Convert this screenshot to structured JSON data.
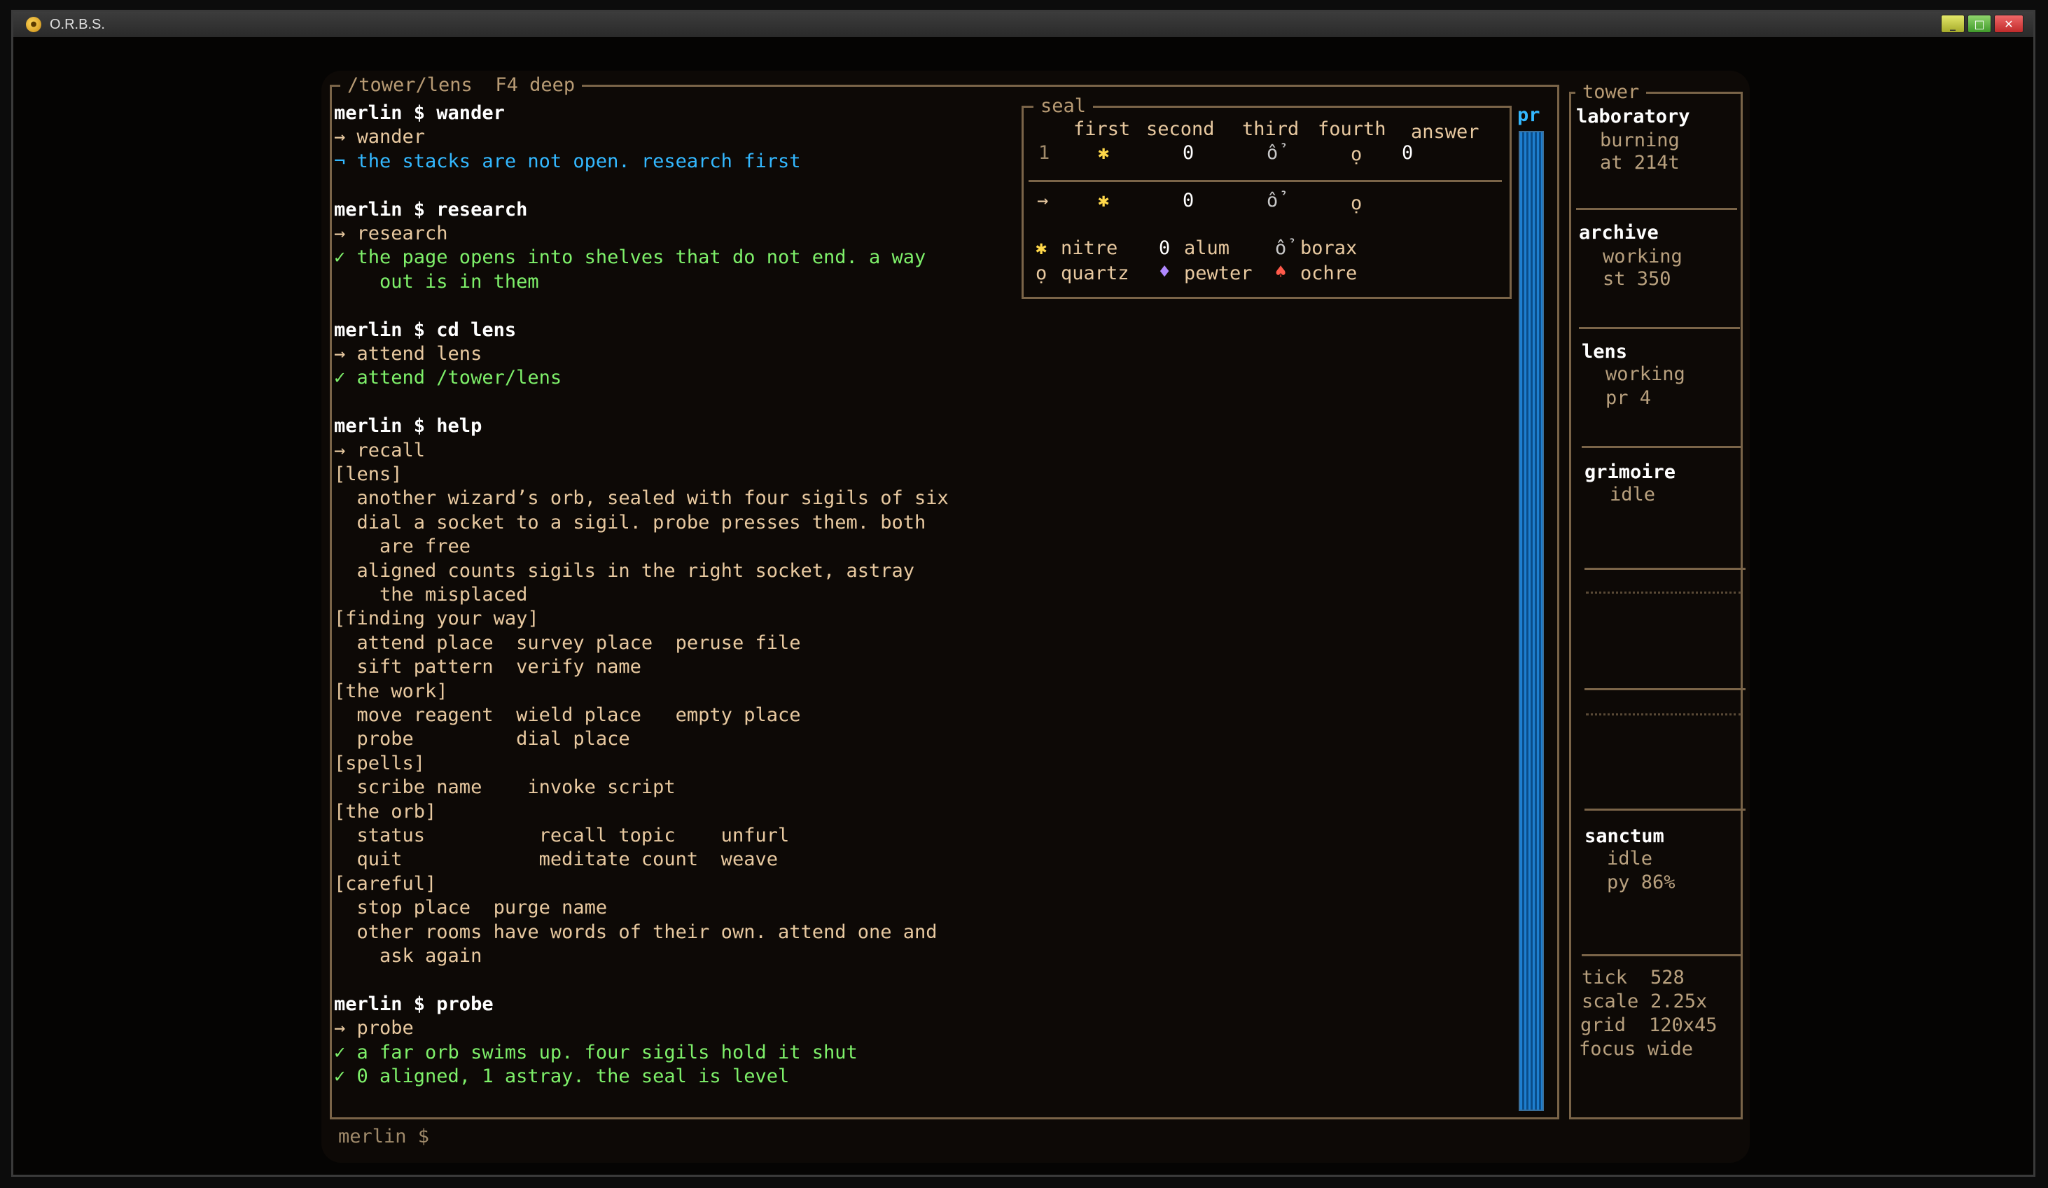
{
  "window": {
    "title": "O.R.B.S.",
    "app_icon": "orb-icon",
    "minimize": "_",
    "maximize": "□",
    "close": "✕"
  },
  "terminal": {
    "frame_title": "/tower/lens  F4 deep",
    "lines": [
      {
        "text": "merlin $ wander",
        "style": "c-white"
      },
      {
        "text": "→ wander",
        "style": "c-tan"
      },
      {
        "text": "¬ the stacks are not open. research first",
        "style": "c-blue"
      },
      {
        "text": "",
        "style": "c-tan"
      },
      {
        "text": "merlin $ research",
        "style": "c-white"
      },
      {
        "text": "→ research",
        "style": "c-tan"
      },
      {
        "text": "✓ the page opens into shelves that do not end. a way",
        "style": "c-green"
      },
      {
        "text": "    out is in them",
        "style": "c-green"
      },
      {
        "text": "",
        "style": "c-tan"
      },
      {
        "text": "merlin $ cd lens",
        "style": "c-white"
      },
      {
        "text": "→ attend lens",
        "style": "c-tan"
      },
      {
        "text": "✓ attend /tower/lens",
        "style": "c-green"
      },
      {
        "text": "",
        "style": "c-tan"
      },
      {
        "text": "merlin $ help",
        "style": "c-white"
      },
      {
        "text": "→ recall",
        "style": "c-tan"
      },
      {
        "text": "[lens]",
        "style": "c-tan"
      },
      {
        "text": "  another wizard’s orb, sealed with four sigils of six",
        "style": "c-tan"
      },
      {
        "text": "  dial a socket to a sigil. probe presses them. both",
        "style": "c-tan"
      },
      {
        "text": "    are free",
        "style": "c-tan"
      },
      {
        "text": "  aligned counts sigils in the right socket, astray",
        "style": "c-tan"
      },
      {
        "text": "    the misplaced",
        "style": "c-tan"
      },
      {
        "text": "[finding your way]",
        "style": "c-tan"
      },
      {
        "text": "  attend place  survey place  peruse file",
        "style": "c-tan"
      },
      {
        "text": "  sift pattern  verify name",
        "style": "c-tan"
      },
      {
        "text": "[the work]",
        "style": "c-tan"
      },
      {
        "text": "  move reagent  wield place   empty place",
        "style": "c-tan"
      },
      {
        "text": "  probe         dial place",
        "style": "c-tan"
      },
      {
        "text": "[spells]",
        "style": "c-tan"
      },
      {
        "text": "  scribe name    invoke script",
        "style": "c-tan"
      },
      {
        "text": "[the orb]",
        "style": "c-tan"
      },
      {
        "text": "  status          recall topic    unfurl",
        "style": "c-tan"
      },
      {
        "text": "  quit            meditate count  weave",
        "style": "c-tan"
      },
      {
        "text": "[careful]",
        "style": "c-tan"
      },
      {
        "text": "  stop place  purge name",
        "style": "c-tan"
      },
      {
        "text": "  other rooms have words of their own. attend one and",
        "style": "c-tan"
      },
      {
        "text": "    ask again",
        "style": "c-tan"
      },
      {
        "text": "",
        "style": "c-tan"
      },
      {
        "text": "merlin $ probe",
        "style": "c-white"
      },
      {
        "text": "→ probe",
        "style": "c-tan"
      },
      {
        "text": "✓ a far orb swims up. four sigils hold it shut",
        "style": "c-green"
      },
      {
        "text": "✓ 0 aligned, 1 astray. the seal is level",
        "style": "c-green"
      }
    ],
    "prompt": "merlin $"
  },
  "seal": {
    "title": "seal",
    "headers": [
      "first",
      "second",
      "third",
      "fourth",
      "answer"
    ],
    "row1": {
      "num": "1",
      "cells": [
        "✱",
        "0",
        "ổ",
        "ọ"
      ],
      "answer": "0"
    },
    "cursor_row": {
      "arrow": "→",
      "cells": [
        "✱",
        "0",
        "ổ",
        "ọ"
      ]
    },
    "legend": [
      {
        "glyph": "✱",
        "name": "nitre",
        "color": "#ffd84a"
      },
      {
        "glyph": "0",
        "name": "alum",
        "color": "#ffffff"
      },
      {
        "glyph": "ổ",
        "name": "borax",
        "color": "#c8c8c8"
      },
      {
        "glyph": "ọ",
        "name": "quartz",
        "color": "#e8c9a0"
      },
      {
        "glyph": "♦",
        "name": "pewter",
        "color": "#b088ff"
      },
      {
        "glyph": "♠",
        "name": "ochre",
        "color": "#ff5a4a"
      }
    ]
  },
  "progress": {
    "label": "pr"
  },
  "tower": {
    "title": "tower",
    "rooms": [
      {
        "name": "laboratory",
        "status": "burning",
        "detail": "at 214t"
      },
      {
        "name": "archive",
        "status": "working",
        "detail": "st 350"
      },
      {
        "name": "lens",
        "status": "working",
        "detail": "pr 4"
      },
      {
        "name": "grimoire",
        "status": "idle",
        "detail": ""
      },
      {
        "name": "sanctum",
        "status": "idle",
        "detail": "py 86%"
      }
    ],
    "stats": [
      {
        "label": "tick",
        "value": "528"
      },
      {
        "label": "scale",
        "value": "2.25x"
      },
      {
        "label": "grid",
        "value": "120x45"
      },
      {
        "label": "focus",
        "value": "wide"
      }
    ]
  },
  "colors": {
    "accent_green": "#7ef06a",
    "accent_blue": "#33b8ff",
    "text": "#e8c9a0",
    "frame": "#7a6448"
  }
}
